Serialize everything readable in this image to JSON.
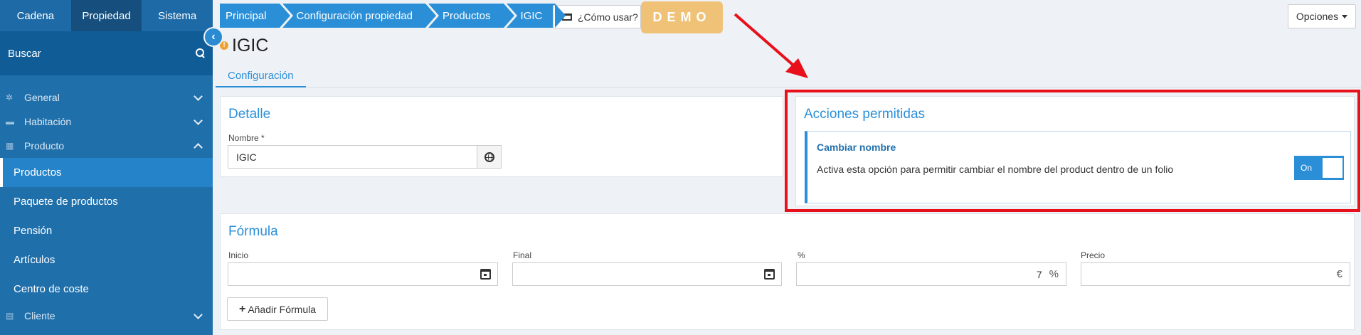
{
  "sidebar": {
    "top_tabs": [
      "Cadena",
      "Propiedad",
      "Sistema"
    ],
    "search_label": "Buscar",
    "menu": [
      {
        "label": "General"
      },
      {
        "label": "Habitación"
      },
      {
        "label": "Producto"
      }
    ],
    "sub_items": [
      "Productos",
      "Paquete de productos",
      "Pensión",
      "Artículos",
      "Centro de coste"
    ],
    "bottom_item": "Cliente"
  },
  "breadcrumb": [
    "Principal",
    "Configuración propiedad",
    "Productos",
    "IGIC"
  ],
  "header": {
    "howto_label": "¿Cómo usar?",
    "demo_badge": "DEMO",
    "options_label": "Opciones"
  },
  "page": {
    "warn_mark": "!",
    "title": "IGIC",
    "tab": "Configuración"
  },
  "detalle": {
    "title": "Detalle",
    "name_label": "Nombre *",
    "name_value": "IGIC"
  },
  "acciones": {
    "title": "Acciones permitidas",
    "item_title": "Cambiar nombre",
    "item_desc": "Activa esta opción para permitir cambiar el nombre del product dentro de un folio",
    "toggle_label": "On"
  },
  "formula": {
    "title": "Fórmula",
    "inicio_label": "Inicio",
    "final_label": "Final",
    "pct_label": "%",
    "pct_value": "7",
    "pct_suffix": "%",
    "precio_label": "Precio",
    "precio_suffix": "€",
    "add_button": "Añadir Fórmula"
  },
  "colors": {
    "accent": "#2b8fd8",
    "sidebar": "#1f6fab",
    "highlight": "#e8101a",
    "demo": "#f0c278"
  }
}
